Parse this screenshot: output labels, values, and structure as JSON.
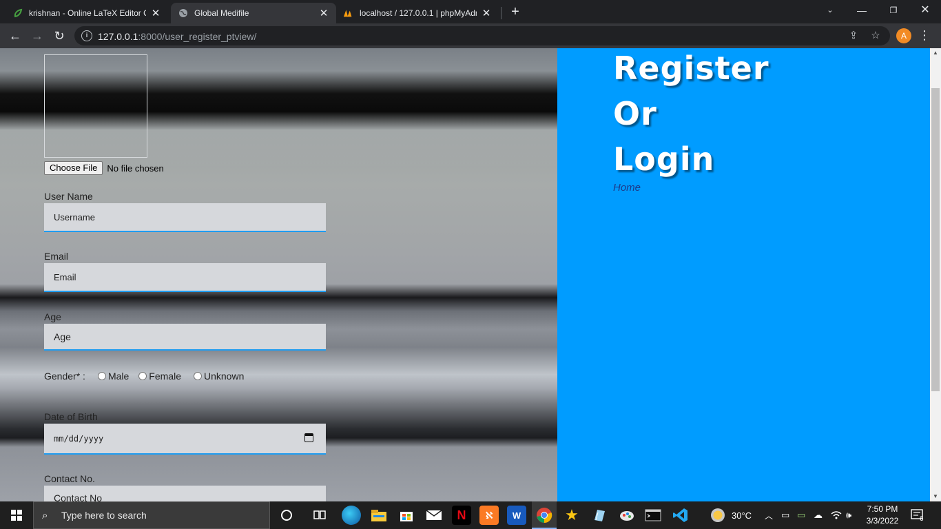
{
  "browser": {
    "tabs": [
      {
        "title": "krishnan - Online LaTeX Editor Ov",
        "icon": "overleaf-leaf-icon",
        "active": false
      },
      {
        "title": "Global Medifile",
        "icon": "globe-icon",
        "active": true
      },
      {
        "title": "localhost / 127.0.0.1 | phpMyAdm",
        "icon": "phpmyadmin-icon",
        "active": false
      }
    ],
    "url_host": "127.0.0.1",
    "url_path": ":8000/user_register_ptview/",
    "profile_initial": "A"
  },
  "form": {
    "file_button": "Choose File",
    "file_status": "No file chosen",
    "username_label": "User Name",
    "username_placeholder": "Username",
    "email_label": "Email",
    "email_placeholder": "Email",
    "age_label": "Age",
    "age_placeholder": "Age",
    "gender_label": "Gender* :",
    "gender_options": [
      "Male",
      "Female",
      "Unknown"
    ],
    "dob_label": "Date of Birth",
    "dob_placeholder": "mm/dd/yyyy",
    "contact_label": "Contact No.",
    "contact_placeholder": "Contact No"
  },
  "right_panel": {
    "title_lines": [
      "Register",
      "Or",
      "Login"
    ],
    "home_link": "Home",
    "bg_color": "#009cff"
  },
  "taskbar": {
    "search_placeholder": "Type here to search",
    "apps": [
      "cortana",
      "task-view",
      "edge",
      "file-explorer",
      "microsoft-store",
      "mail",
      "netflix",
      "xampp",
      "word",
      "chrome",
      "star-app",
      "notepad",
      "paint",
      "terminal",
      "vscode"
    ],
    "weather": "30°C",
    "time": "7:50 PM",
    "date": "3/3/2022",
    "notification_count": "6"
  }
}
